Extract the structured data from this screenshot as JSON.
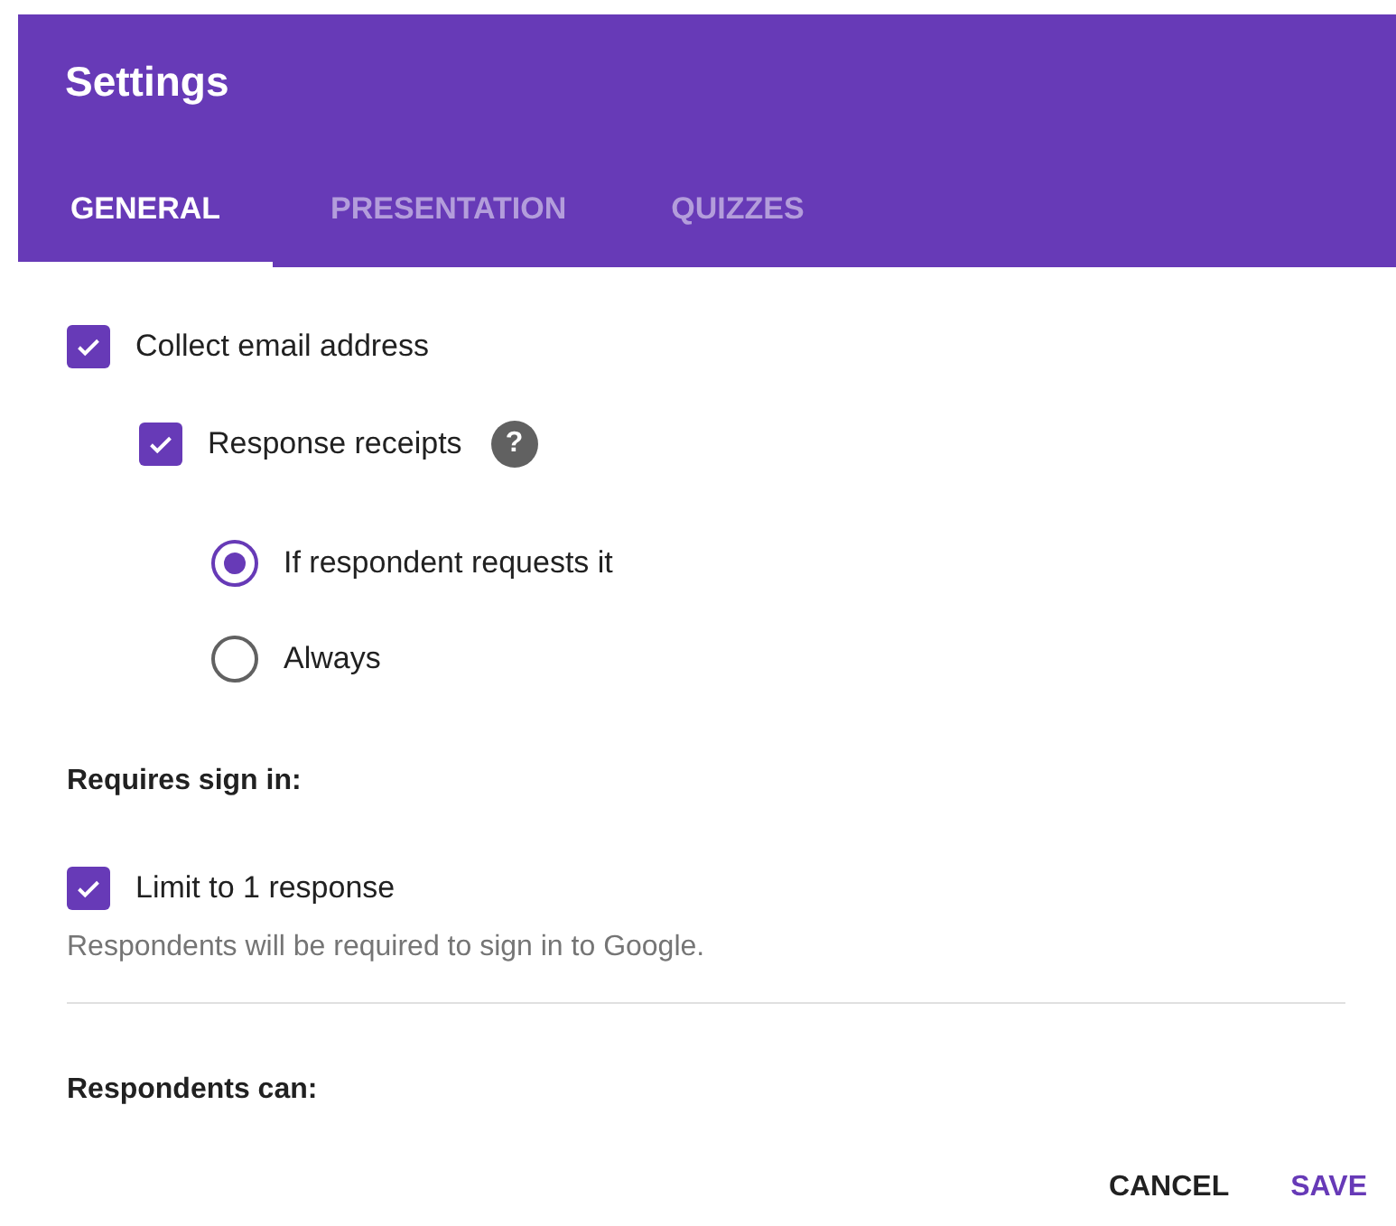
{
  "title": "Settings",
  "tabs": [
    {
      "label": "GENERAL",
      "selected": true
    },
    {
      "label": "PRESENTATION",
      "selected": false
    },
    {
      "label": "QUIZZES",
      "selected": false
    }
  ],
  "options": [
    {
      "kind": "checkbox",
      "label": "Collect email address",
      "checked": true,
      "children": [
        {
          "kind": "checkbox",
          "label": "Response receipts",
          "checked": true,
          "help": "?",
          "children": [
            {
              "kind": "radio",
              "label": "If respondent requests it",
              "selected": true
            },
            {
              "kind": "radio",
              "label": "Always",
              "selected": false
            }
          ]
        }
      ]
    }
  ],
  "sign_in": {
    "heading": "Requires sign in:",
    "option": {
      "kind": "checkbox",
      "label": "Limit to 1 response",
      "checked": true
    },
    "note": "Respondents will be required to sign in to Google."
  },
  "respondents": {
    "heading": "Respondents can:"
  },
  "buttons": [
    {
      "label": "CANCEL",
      "kind": "plain"
    },
    {
      "label": "SAVE",
      "kind": "primary"
    }
  ]
}
